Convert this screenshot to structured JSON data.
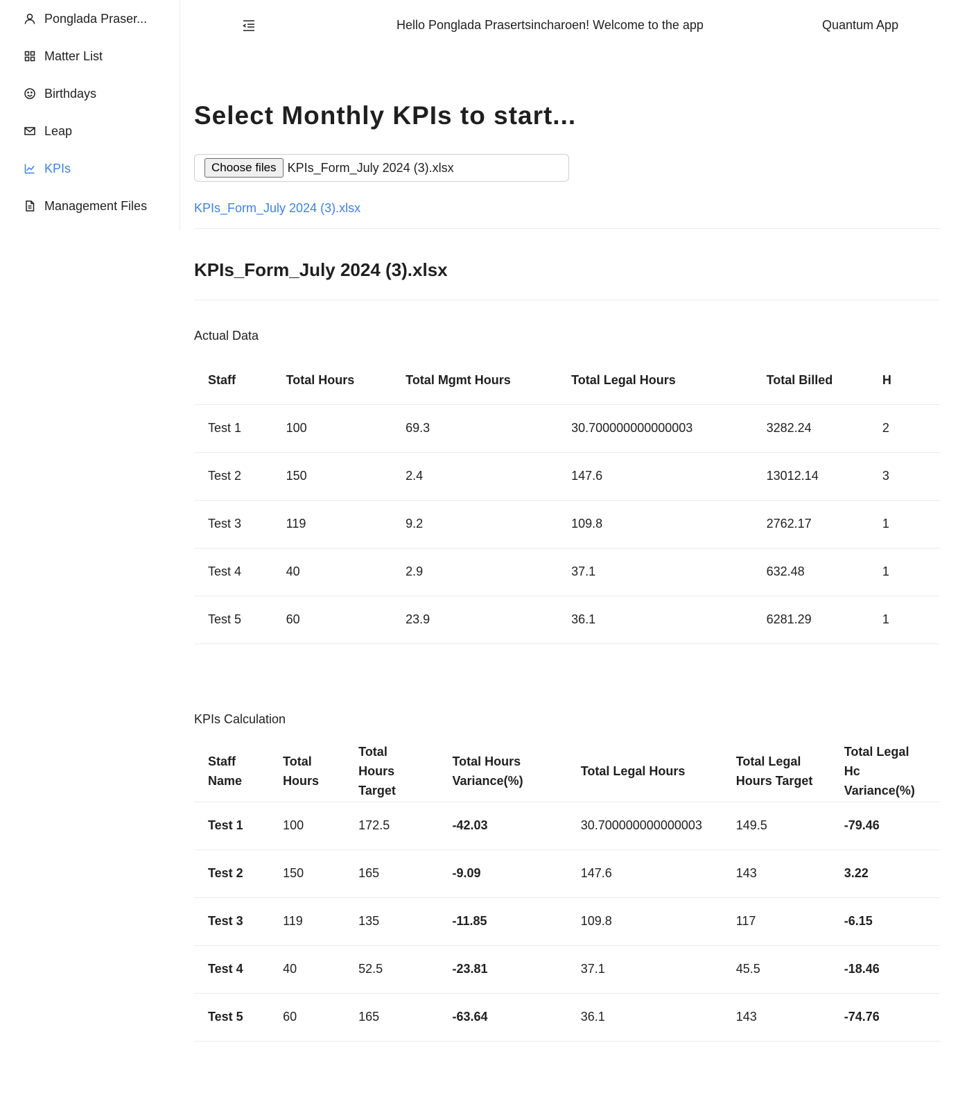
{
  "sidebar": {
    "items": [
      {
        "label": "Ponglada Praser...",
        "icon": "user-icon",
        "active": false
      },
      {
        "label": "Matter List",
        "icon": "grid-icon",
        "active": false
      },
      {
        "label": "Birthdays",
        "icon": "smile-icon",
        "active": false
      },
      {
        "label": "Leap",
        "icon": "mail-icon",
        "active": false
      },
      {
        "label": "KPIs",
        "icon": "line-chart-icon",
        "active": true
      },
      {
        "label": "Management Files",
        "icon": "file-icon",
        "active": false
      }
    ]
  },
  "header": {
    "greeting": "Hello Ponglada Prasertsincharoen! Welcome to the app",
    "app_name": "Quantum App"
  },
  "main": {
    "title": "Select Monthly KPIs to start...",
    "file_input": {
      "button_label": "Choose files",
      "file_name": "KPIs_Form_July 2024 (3).xlsx"
    },
    "file_link": "KPIs_Form_July 2024 (3).xlsx",
    "section_title": "KPIs_Form_July 2024 (3).xlsx",
    "actual": {
      "label": "Actual Data",
      "columns": [
        "Staff",
        "Total Hours",
        "Total Mgmt Hours",
        "Total Legal Hours",
        "Total Billed",
        "H"
      ],
      "rows": [
        [
          "Test 1",
          "100",
          "69.3",
          "30.700000000000003",
          "3282.24",
          "2"
        ],
        [
          "Test 2",
          "150",
          "2.4",
          "147.6",
          "13012.14",
          "3"
        ],
        [
          "Test 3",
          "119",
          "9.2",
          "109.8",
          "2762.17",
          "1"
        ],
        [
          "Test 4",
          "40",
          "2.9",
          "37.1",
          "632.48",
          "1"
        ],
        [
          "Test 5",
          "60",
          "23.9",
          "36.1",
          "6281.29",
          "1"
        ]
      ]
    },
    "kpis": {
      "label": "KPIs Calculation",
      "columns": [
        "Staff Name",
        "Total Hours",
        "Total Hours Target",
        "Total Hours Variance(%)",
        "Total Legal Hours",
        "Total Legal Hours Target",
        "Total Legal Hc Variance(%)"
      ],
      "rows": [
        [
          "Test 1",
          "100",
          "172.5",
          "-42.03",
          "30.700000000000003",
          "149.5",
          "-79.46"
        ],
        [
          "Test 2",
          "150",
          "165",
          "-9.09",
          "147.6",
          "143",
          "3.22"
        ],
        [
          "Test 3",
          "119",
          "135",
          "-11.85",
          "109.8",
          "117",
          "-6.15"
        ],
        [
          "Test 4",
          "40",
          "52.5",
          "-23.81",
          "37.1",
          "45.5",
          "-18.46"
        ],
        [
          "Test 5",
          "60",
          "165",
          "-63.64",
          "36.1",
          "143",
          "-74.76"
        ]
      ]
    }
  },
  "colors": {
    "accent": "#3b82e6",
    "text": "#1f1f1f",
    "divider": "#ececec"
  }
}
